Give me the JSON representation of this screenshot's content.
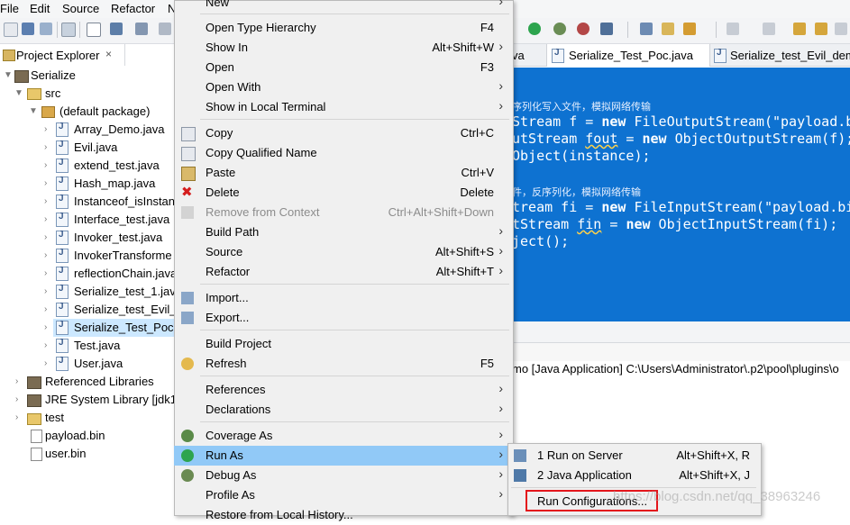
{
  "menubar": {
    "items": [
      "File",
      "Edit",
      "Source",
      "Refactor",
      "N"
    ]
  },
  "project_explorer": {
    "title": "Project Explorer",
    "close_glyph": "×",
    "rows": [
      "Serialize",
      "src",
      "(default package)",
      "Array_Demo.java",
      "Evil.java",
      "extend_test.java",
      "Hash_map.java",
      "Instanceof_isInstanc",
      "Interface_test.java",
      "Invoker_test.java",
      "InvokerTransforme",
      "reflectionChain.java",
      "Serialize_test_1.java",
      "Serialize_test_Evil_d",
      "Serialize_Test_Poc.ja",
      "Test.java",
      "User.java",
      "Referenced Libraries",
      "JRE System Library [jdk1",
      "test",
      "payload.bin",
      "user.bin"
    ]
  },
  "editor": {
    "tabs": [
      "va",
      "Serialize_Test_Poc.java",
      "Serialize_test_Evil_demo"
    ],
    "lines": [
      {
        "type": "comment",
        "text": "序列化写入文件，模拟网络传输"
      },
      {
        "type": "code",
        "kw": "",
        "text": "Stream f = ",
        "kw2": "new",
        "rest": " FileOutputStream(\"payload.b"
      },
      {
        "type": "code",
        "text": "utStream ",
        "u": "fout",
        "mid": " = ",
        "kw2": "new",
        "rest": " ObjectOutputStream(f);"
      },
      {
        "type": "code",
        "text": "Object(instance);",
        "kw2": "",
        "rest": ""
      },
      {
        "type": "comment",
        "text": "件，反序列化，模拟网络传输"
      },
      {
        "type": "code",
        "text": "tream fi = ",
        "kw2": "new",
        "rest": " FileInputStream(\"payload.bi"
      },
      {
        "type": "code",
        "text": "tStream ",
        "u": "fin",
        "mid": " = ",
        "kw2": "new",
        "rest": " ObjectInputStream(fi);"
      },
      {
        "type": "code",
        "text": "ject();",
        "kw2": "",
        "rest": ""
      }
    ]
  },
  "console": {
    "text": "mo [Java Application] C:\\Users\\Administrator\\.p2\\pool\\plugins\\o"
  },
  "context_menu": {
    "items": [
      {
        "label": "New",
        "accel": "",
        "sub": "›"
      },
      {
        "label": "Open Type Hierarchy",
        "accel": "F4"
      },
      {
        "label": "Show In",
        "accel": "Alt+Shift+W",
        "sub": "›"
      },
      {
        "label": "Open",
        "accel": "F3"
      },
      {
        "label": "Open With",
        "accel": "",
        "sub": "›"
      },
      {
        "label": "Show in Local Terminal",
        "accel": "",
        "sub": "›"
      },
      {
        "label": "Copy",
        "accel": "Ctrl+C"
      },
      {
        "label": "Copy Qualified Name",
        "accel": ""
      },
      {
        "label": "Paste",
        "accel": "Ctrl+V"
      },
      {
        "label": "Delete",
        "accel": "Delete"
      },
      {
        "label": "Remove from Context",
        "accel": "Ctrl+Alt+Shift+Down"
      },
      {
        "label": "Build Path",
        "accel": "",
        "sub": "›"
      },
      {
        "label": "Source",
        "accel": "Alt+Shift+S",
        "sub": "›"
      },
      {
        "label": "Refactor",
        "accel": "Alt+Shift+T",
        "sub": "›"
      },
      {
        "label": "Import...",
        "accel": ""
      },
      {
        "label": "Export...",
        "accel": ""
      },
      {
        "label": "Build Project",
        "accel": ""
      },
      {
        "label": "Refresh",
        "accel": "F5"
      },
      {
        "label": "References",
        "accel": "",
        "sub": "›"
      },
      {
        "label": "Declarations",
        "accel": "",
        "sub": "›"
      },
      {
        "label": "Coverage As",
        "accel": "",
        "sub": "›"
      },
      {
        "label": "Run As",
        "accel": "",
        "sub": "›"
      },
      {
        "label": "Debug As",
        "accel": "",
        "sub": "›"
      },
      {
        "label": "Profile As",
        "accel": "",
        "sub": "›"
      },
      {
        "label": "Restore from Local History...",
        "accel": ""
      }
    ]
  },
  "run_as_submenu": {
    "items": [
      {
        "label": "1 Run on Server",
        "accel": "Alt+Shift+X, R"
      },
      {
        "label": "2 Java Application",
        "accel": "Alt+Shift+X, J"
      },
      {
        "label": "Run Configurations...",
        "accel": ""
      }
    ]
  },
  "watermark": "https://blog.csdn.net/qq_38963246",
  "colors": {
    "editor_bg": "#0e72d1",
    "menu_highlight": "#91c9f7",
    "selection": "#cce8ff",
    "annotation": "#e4161c"
  }
}
